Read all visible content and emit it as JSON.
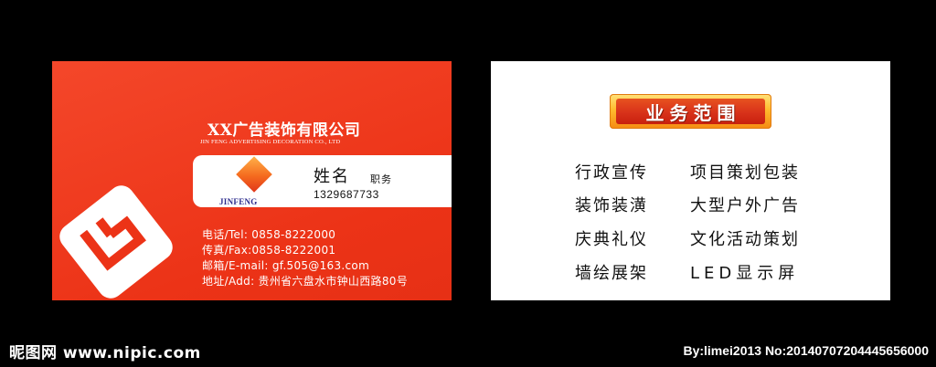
{
  "front": {
    "company_cn": "XX广告装饰有限公司",
    "company_en": "JIN FENG ADVERTISING DECORATION CO., LTD",
    "brand": "JINFENG",
    "name": "姓名",
    "title": "职务",
    "phone": "1329687733",
    "contacts": [
      "电话/Tel: 0858-8222000",
      "传真/Fax:0858-8222001",
      "邮箱/E-mail: gf.505@163.com",
      "地址/Add: 贵州省六盘水市钟山西路80号"
    ]
  },
  "back": {
    "heading": "业务范围",
    "services": [
      "行政宣传",
      "项目策划包装",
      "装饰装潢",
      "大型户外广告",
      "庆典礼仪",
      "文化活动策划",
      "墙绘展架",
      "LED显示屏"
    ]
  },
  "watermark": {
    "left": "昵图网 www.nipic.com",
    "right": "By:limei2013 No:20140707204445656000"
  },
  "colors": {
    "card_red": "#f0381f",
    "brand_blue": "#2b2b8c",
    "badge_orange": "#ffbb2e",
    "badge_red": "#d8321a"
  }
}
